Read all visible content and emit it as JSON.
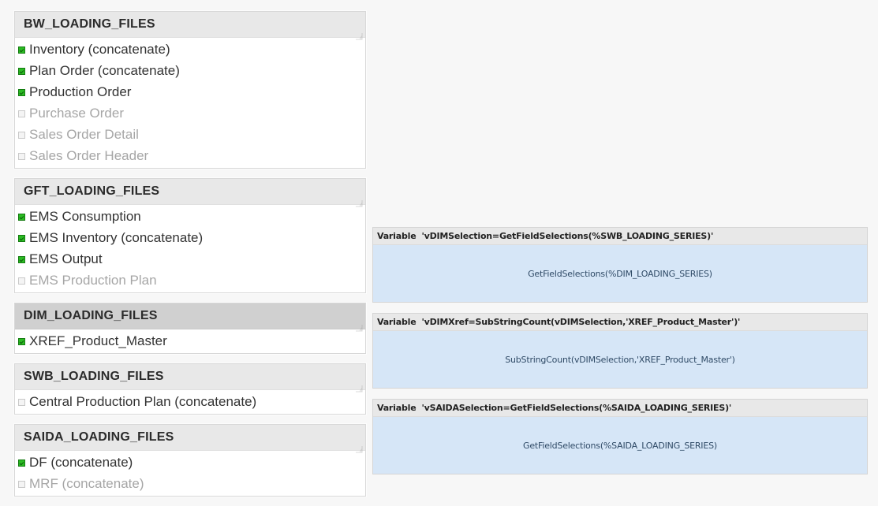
{
  "listboxes": [
    {
      "title": "BW_LOADING_FILES",
      "active": false,
      "items": [
        {
          "label": "Inventory (concatenate)",
          "state": "selected"
        },
        {
          "label": "Plan Order (concatenate)",
          "state": "selected"
        },
        {
          "label": "Production Order",
          "state": "selected"
        },
        {
          "label": "Purchase Order",
          "state": "excluded"
        },
        {
          "label": "Sales Order Detail",
          "state": "excluded"
        },
        {
          "label": "Sales Order Header",
          "state": "excluded"
        }
      ]
    },
    {
      "title": "GFT_LOADING_FILES",
      "active": false,
      "items": [
        {
          "label": "EMS Consumption",
          "state": "selected"
        },
        {
          "label": "EMS Inventory (concatenate)",
          "state": "selected"
        },
        {
          "label": "EMS Output",
          "state": "selected"
        },
        {
          "label": "EMS Production Plan",
          "state": "excluded"
        }
      ]
    },
    {
      "title": "DIM_LOADING_FILES",
      "active": true,
      "items": [
        {
          "label": "XREF_Product_Master",
          "state": "selected"
        }
      ]
    },
    {
      "title": "SWB_LOADING_FILES",
      "active": false,
      "items": [
        {
          "label": "Central Production Plan (concatenate)",
          "state": "optional"
        }
      ]
    },
    {
      "title": "SAIDA_LOADING_FILES",
      "active": false,
      "items": [
        {
          "label": "DF (concatenate)",
          "state": "selected"
        },
        {
          "label": "MRF (concatenate)",
          "state": "excluded"
        }
      ]
    }
  ],
  "variable_boxes": [
    {
      "caption_keyword": "Variable",
      "caption_expression": "'vDIMSelection=GetFieldSelections(%SWB_LOADING_SERIES)'",
      "value": "GetFieldSelections(%DIM_LOADING_SERIES)"
    },
    {
      "caption_keyword": "Variable",
      "caption_expression": "'vDIMXref=SubStringCount(vDIMSelection,'XREF_Product_Master')'",
      "value": "SubStringCount(vDIMSelection,'XREF_Product_Master')"
    },
    {
      "caption_keyword": "Variable",
      "caption_expression": "'vSAIDASelection=GetFieldSelections(%SAIDA_LOADING_SERIES)'",
      "value": "GetFieldSelections(%SAIDA_LOADING_SERIES)"
    }
  ],
  "colors": {
    "page_background": "#f7f7f7",
    "caption_background": "#e8e8e8",
    "caption_background_active": "#d0d0d0",
    "list_background": "#ffffff",
    "selected_green": "#2bbb23",
    "excluded_text": "#a6a6a6",
    "variable_body_blue": "#d6e6f7",
    "variable_value_text": "#2f4a66"
  }
}
